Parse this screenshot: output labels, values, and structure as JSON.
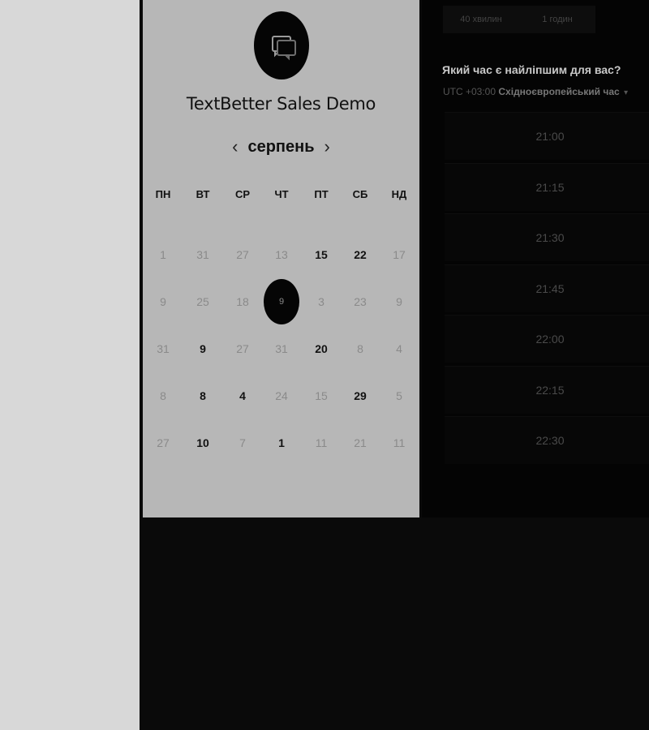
{
  "event": {
    "title": "TextBetter Sales Demo",
    "icon": "chat-bubbles-icon"
  },
  "calendar": {
    "month": "серпень",
    "prev_icon": "chevron-left-icon",
    "next_icon": "chevron-right-icon",
    "weekdays": [
      "ПН",
      "ВТ",
      "СР",
      "ЧТ",
      "ПТ",
      "СБ",
      "НД"
    ],
    "weeks": [
      [
        {
          "d": "1",
          "a": false
        },
        {
          "d": "31",
          "a": false
        },
        {
          "d": "27",
          "a": false
        },
        {
          "d": "13",
          "a": false
        },
        {
          "d": "15",
          "a": true
        },
        {
          "d": "22",
          "a": true
        },
        {
          "d": "17",
          "a": false
        }
      ],
      [
        {
          "d": "9",
          "a": false
        },
        {
          "d": "25",
          "a": false
        },
        {
          "d": "18",
          "a": false
        },
        {
          "d": "9",
          "a": false,
          "s": true
        },
        {
          "d": "3",
          "a": false
        },
        {
          "d": "23",
          "a": false
        },
        {
          "d": "9",
          "a": false
        }
      ],
      [
        {
          "d": "31",
          "a": false
        },
        {
          "d": "9",
          "a": true
        },
        {
          "d": "27",
          "a": false
        },
        {
          "d": "31",
          "a": false
        },
        {
          "d": "20",
          "a": true
        },
        {
          "d": "8",
          "a": false
        },
        {
          "d": "4",
          "a": false
        }
      ],
      [
        {
          "d": "8",
          "a": false
        },
        {
          "d": "8",
          "a": true
        },
        {
          "d": "4",
          "a": true
        },
        {
          "d": "24",
          "a": false
        },
        {
          "d": "15",
          "a": false
        },
        {
          "d": "29",
          "a": true
        },
        {
          "d": "5",
          "a": false
        }
      ],
      [
        {
          "d": "27",
          "a": false
        },
        {
          "d": "10",
          "a": true
        },
        {
          "d": "7",
          "a": false
        },
        {
          "d": "1",
          "a": true
        },
        {
          "d": "11",
          "a": false
        },
        {
          "d": "21",
          "a": false
        },
        {
          "d": "11",
          "a": false
        }
      ]
    ]
  },
  "durations": [
    "40 хвилин",
    "1 годин"
  ],
  "question": "Який час є найліпшим для вас?",
  "timezone": {
    "offset": "UTC +03:00",
    "name": "Східноєвропейський час",
    "caret_icon": "caret-down-icon"
  },
  "slots": [
    "21:00",
    "21:15",
    "21:30",
    "21:45",
    "22:00",
    "22:15",
    "22:30"
  ]
}
